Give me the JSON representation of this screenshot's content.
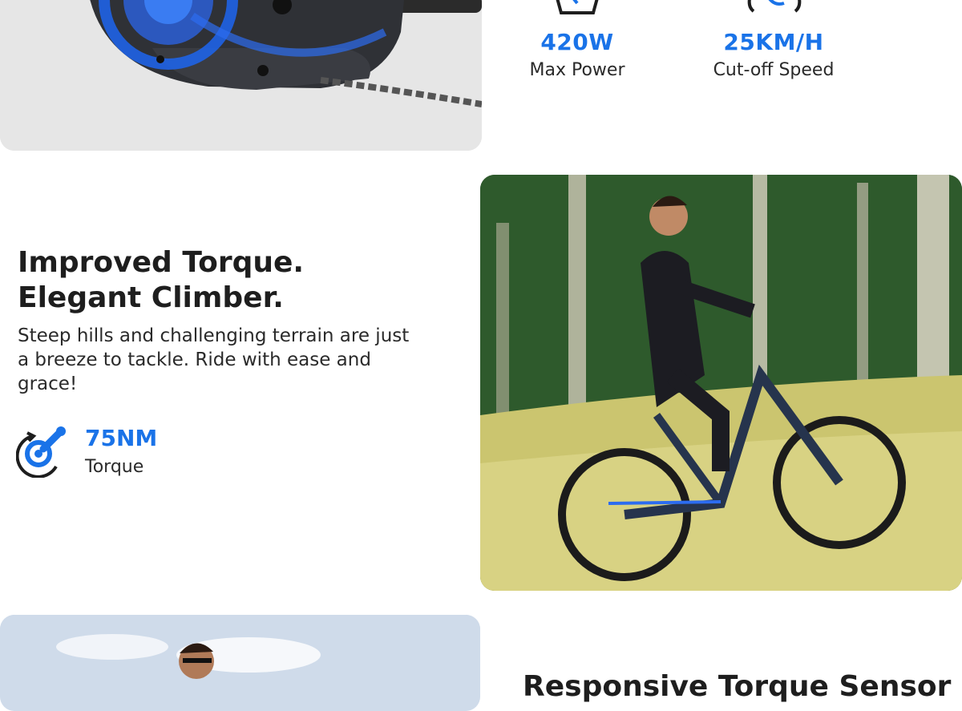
{
  "stats": {
    "power": {
      "value": "420W",
      "label": "Max Power",
      "icon": "power-gauge-icon"
    },
    "speed": {
      "value": "25KM/H",
      "label": "Cut-off Speed",
      "icon": "speedometer-icon"
    }
  },
  "feature": {
    "headline_line1": "Improved Torque.",
    "headline_line2": "Elegant Climber.",
    "body": "Steep hills and challenging terrain are just a breeze to tackle. Ride with ease and grace!",
    "torque_value": "75NM",
    "torque_label": "Torque",
    "torque_icon": "torque-icon"
  },
  "next_section": {
    "heading": "Responsive Torque Sensor"
  },
  "images": {
    "motor": "mid-drive-motor-closeup",
    "ride": "man-in-suit-riding-ebike-on-grass",
    "sky": "rider-against-sky"
  },
  "colors": {
    "accent": "#1a73e8",
    "text": "#1e1e1e",
    "muted": "#2a2a2a"
  }
}
